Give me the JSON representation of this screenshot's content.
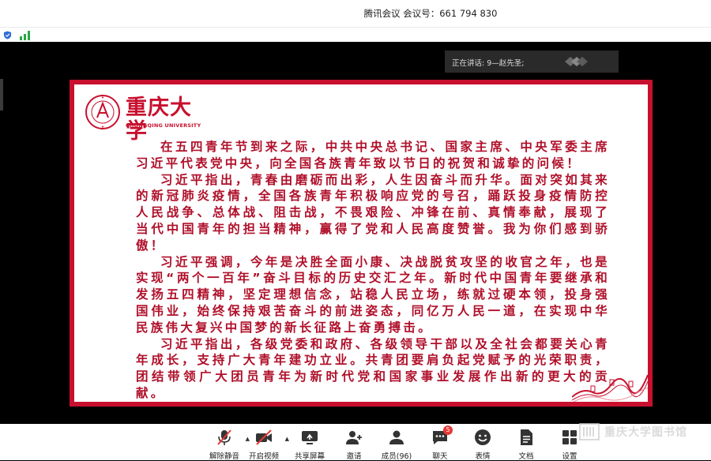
{
  "window": {
    "title": "腾讯会议 会议号：661 794 830"
  },
  "speaking": {
    "label": "正在讲话: 9—赵先圣;"
  },
  "slide": {
    "logo": {
      "name_cn": "重庆大学",
      "name_en": "CHONGQING UNIVERSITY"
    },
    "paragraphs": [
      "在五四青年节到来之际，中共中央总书记、国家主席、中央军委主席习近平代表党中央，向全国各族青年致以节日的祝贺和诚挚的问候！",
      "习近平指出，青春由磨砺而出彩，人生因奋斗而升华。面对突如其来的新冠肺炎疫情，全国各族青年积极响应党的号召，踊跃投身疫情防控人民战争、总体战、阻击战，不畏艰险、冲锋在前、真情奉献，展现了当代中国青年的担当精神，赢得了党和人民高度赞誉。我为你们感到骄傲！",
      "习近平强调，今年是决胜全面小康、决战脱贫攻坚的收官之年，也是实现“两个一百年”奋斗目标的历史交汇之年。新时代中国青年要继承和发扬五四精神，坚定理想信念，站稳人民立场，练就过硬本领，投身强国伟业，始终保持艰苦奋斗的前进姿态，同亿万人民一道，在实现中华民族伟大复兴中国梦的新长征路上奋勇搏击。",
      "习近平指出，各级党委和政府、各级领导干部以及全社会都要关心青年成长，支持广大青年建功立业。共青团要肩负起党赋予的光荣职责，团结带领广大团员青年为新时代党和国家事业发展作出新的更大的贡献。"
    ]
  },
  "toolbar": {
    "unmute": "解除静音",
    "video": "开启视频",
    "share": "共享屏幕",
    "invite": "邀请",
    "members": "成员(96)",
    "chat": "聊天",
    "chat_badge": "5",
    "reactions": "表情",
    "docs": "文档",
    "settings": "设置"
  },
  "watermark": {
    "text": "重庆大学图书馆"
  },
  "colors": {
    "accent": "#c8102e",
    "slide_text": "#b0102a"
  }
}
